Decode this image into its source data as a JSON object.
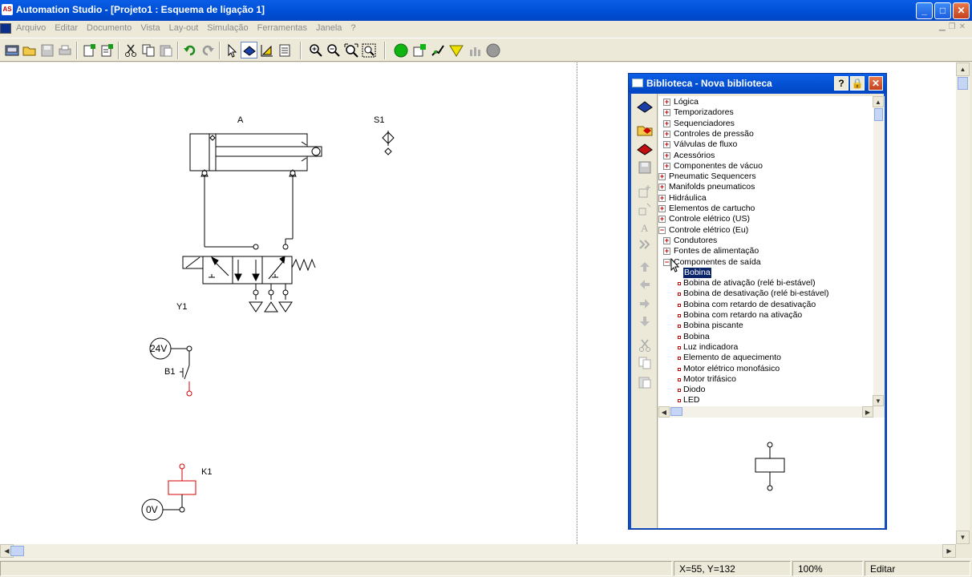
{
  "window": {
    "title": "Automation Studio - [Projeto1 : Esquema de ligação 1]",
    "app_icon_text": "AS"
  },
  "menu": {
    "items": [
      "Arquivo",
      "Editar",
      "Documento",
      "Vista",
      "Lay-out",
      "Simulação",
      "Ferramentas",
      "Janela",
      "?"
    ]
  },
  "diagram": {
    "cylinder_label": "A",
    "sensor_label": "S1",
    "valve_label": "Y1",
    "supply_label": "24V",
    "switch_label": "B1",
    "ground_label": "0V",
    "coil_label": "K1"
  },
  "library": {
    "title": "Biblioteca - Nova biblioteca",
    "tree": [
      {
        "label": "Lógica",
        "level": 1,
        "kind": "plus"
      },
      {
        "label": "Temporizadores",
        "level": 1,
        "kind": "plus"
      },
      {
        "label": "Sequenciadores",
        "level": 1,
        "kind": "plus"
      },
      {
        "label": "Controles de pressão",
        "level": 1,
        "kind": "plus"
      },
      {
        "label": "Válvulas de fluxo",
        "level": 1,
        "kind": "plus"
      },
      {
        "label": "Acessórios",
        "level": 1,
        "kind": "plus"
      },
      {
        "label": "Componentes de vácuo",
        "level": 1,
        "kind": "plus"
      },
      {
        "label": "Pneumatic Sequencers",
        "level": 0,
        "kind": "plus"
      },
      {
        "label": "Manifolds pneumaticos",
        "level": 0,
        "kind": "plus"
      },
      {
        "label": "Hidráulica",
        "level": 0,
        "kind": "plus"
      },
      {
        "label": "Elementos de cartucho",
        "level": 0,
        "kind": "plus"
      },
      {
        "label": "Controle elétrico (US)",
        "level": 0,
        "kind": "plus"
      },
      {
        "label": "Controle elétrico (Eu)",
        "level": 0,
        "kind": "minus"
      },
      {
        "label": "Condutores",
        "level": 1,
        "kind": "plus"
      },
      {
        "label": "Fontes de alimentação",
        "level": 1,
        "kind": "plus"
      },
      {
        "label": "Componentes de saída",
        "level": 1,
        "kind": "minus"
      },
      {
        "label": "Bobina",
        "level": 2,
        "kind": "selected"
      },
      {
        "label": "Bobina de ativação (relé bi-estável)",
        "level": 2,
        "kind": "leaf"
      },
      {
        "label": "Bobina de desativação (relé bi-estável)",
        "level": 2,
        "kind": "leaf"
      },
      {
        "label": "Bobina com retardo de desativação",
        "level": 2,
        "kind": "leaf"
      },
      {
        "label": "Bobina com retardo na ativação",
        "level": 2,
        "kind": "leaf"
      },
      {
        "label": "Bobina piscante",
        "level": 2,
        "kind": "leaf"
      },
      {
        "label": "Bobina",
        "level": 2,
        "kind": "leaf"
      },
      {
        "label": "Luz indicadora",
        "level": 2,
        "kind": "leaf"
      },
      {
        "label": "Elemento de aquecimento",
        "level": 2,
        "kind": "leaf"
      },
      {
        "label": "Motor elétrico monofásico",
        "level": 2,
        "kind": "leaf"
      },
      {
        "label": "Motor trifásico",
        "level": 2,
        "kind": "leaf"
      },
      {
        "label": "Diodo",
        "level": 2,
        "kind": "leaf"
      },
      {
        "label": "LED",
        "level": 2,
        "kind": "leaf"
      }
    ]
  },
  "status": {
    "coords": "X=55, Y=132",
    "zoom": "100%",
    "mode": "Editar"
  },
  "colors": {
    "titlebar": "#0050d8",
    "wire_red": "#d40000",
    "selection": "#0a246a"
  }
}
